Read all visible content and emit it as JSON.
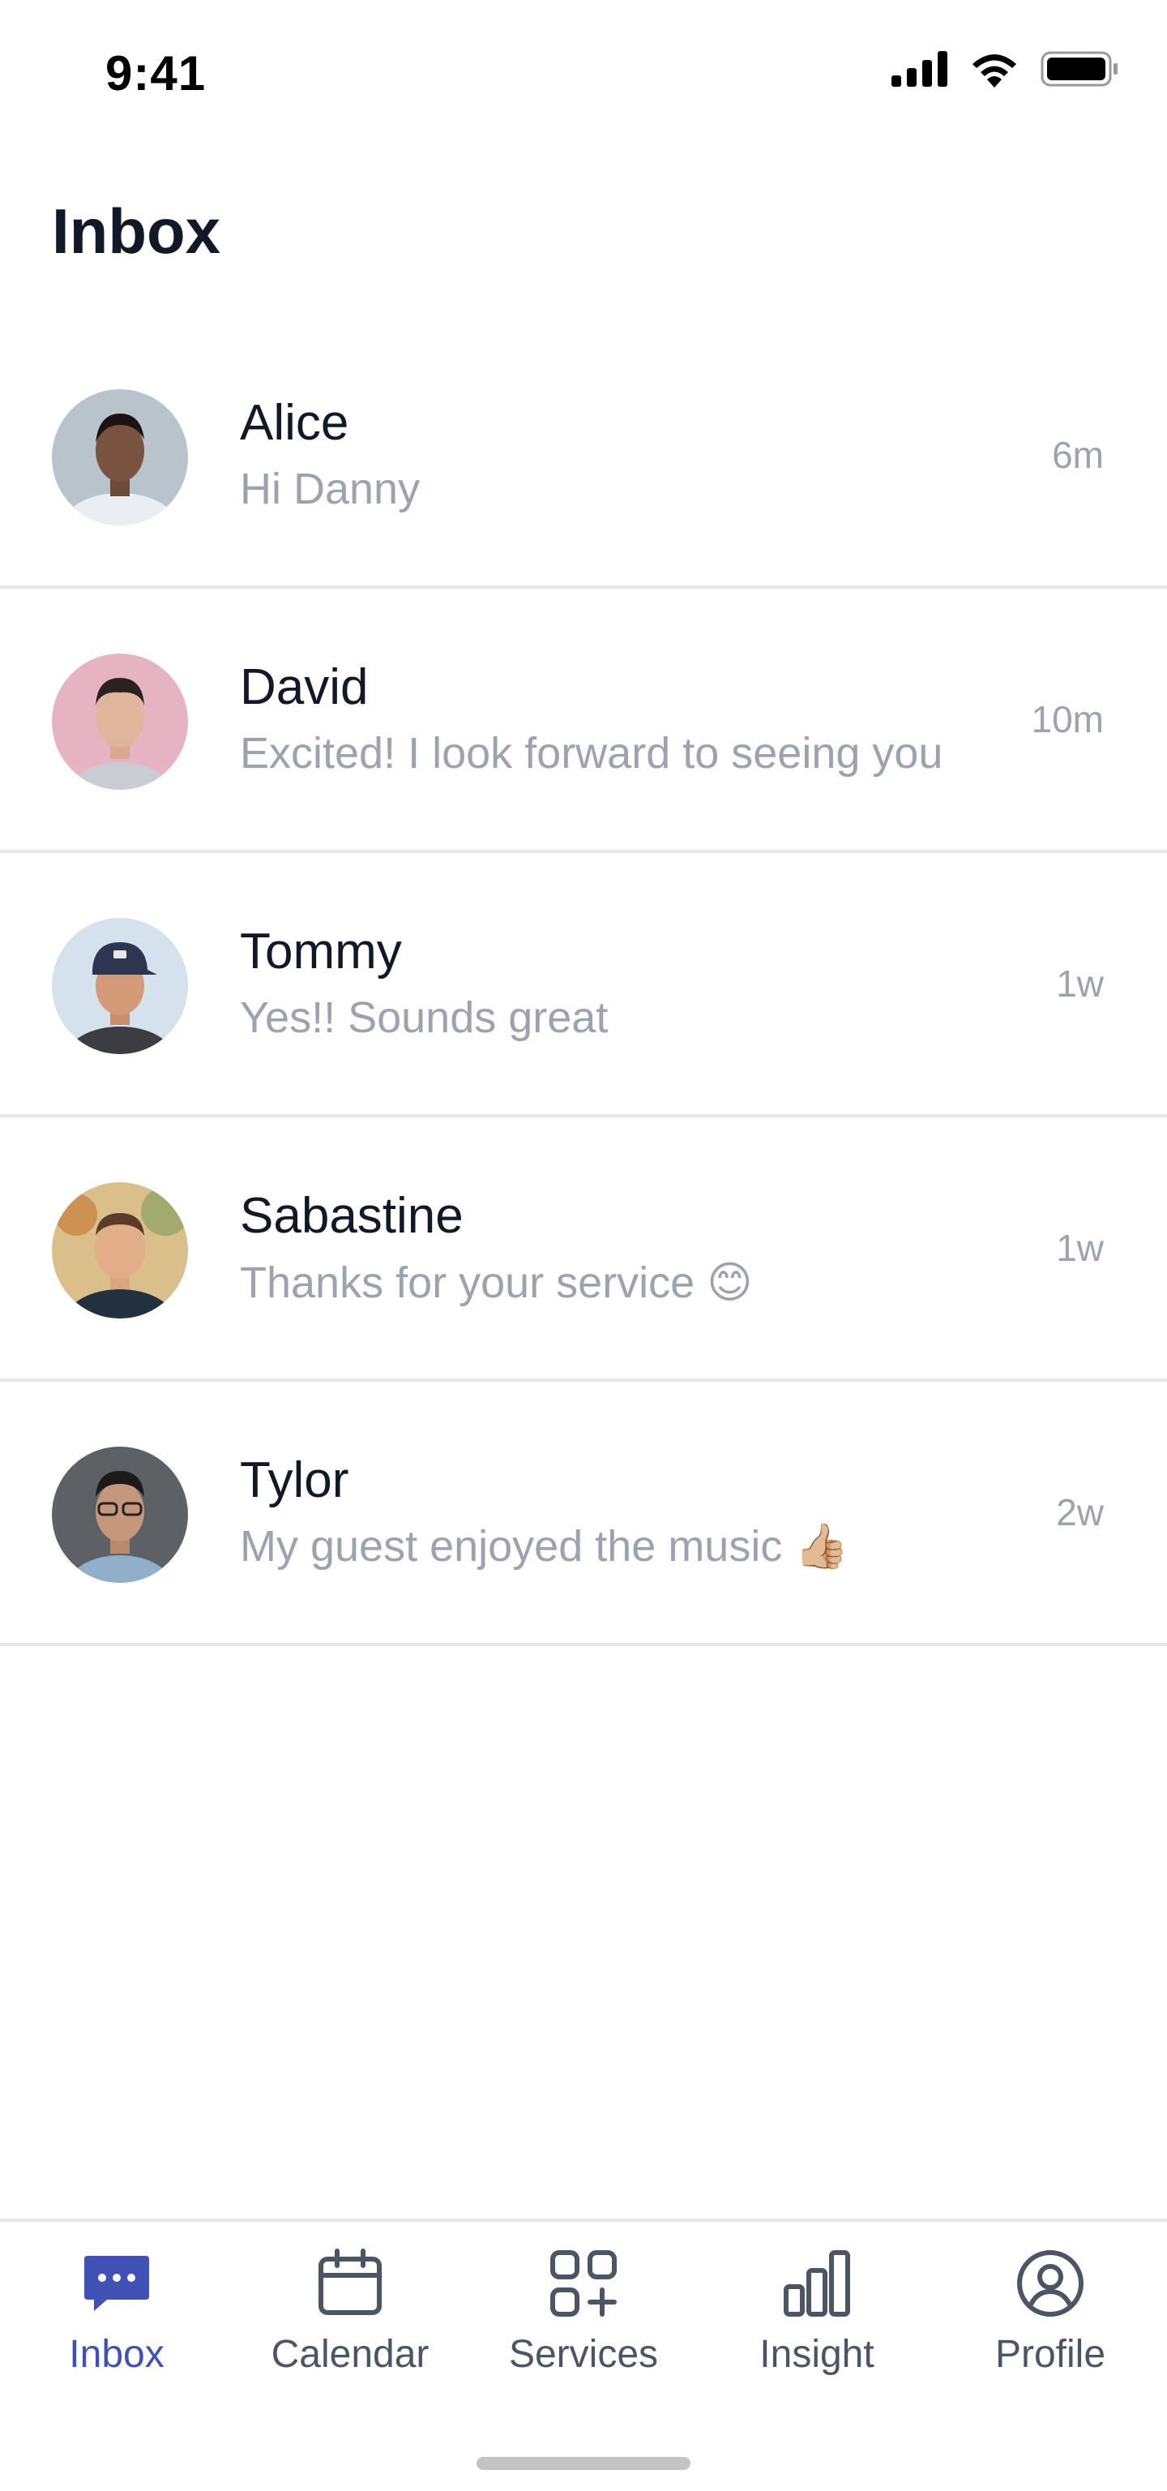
{
  "status_bar": {
    "time": "9:41",
    "icons": [
      "cellular-signal-icon",
      "wifi-icon",
      "battery-icon"
    ]
  },
  "header": {
    "title": "Inbox"
  },
  "conversations": [
    {
      "name": "Alice",
      "preview": "Hi Danny",
      "time": "6m",
      "avatar_icon": "avatar-alice"
    },
    {
      "name": "David",
      "preview": "Excited! I look forward to seeing you",
      "time": "10m",
      "avatar_icon": "avatar-david"
    },
    {
      "name": "Tommy",
      "preview": "Yes!! Sounds great",
      "time": "1w",
      "avatar_icon": "avatar-tommy"
    },
    {
      "name": "Sabastine",
      "preview": "Thanks for your service 😊",
      "time": "1w",
      "avatar_icon": "avatar-sabastine"
    },
    {
      "name": "Tylor",
      "preview": "My guest enjoyed the music 👍🏼",
      "time": "2w",
      "avatar_icon": "avatar-tylor"
    }
  ],
  "tab_bar": {
    "active": "Inbox",
    "tabs": [
      {
        "label": "Inbox",
        "icon": "chat-bubble-icon"
      },
      {
        "label": "Calendar",
        "icon": "calendar-icon"
      },
      {
        "label": "Services",
        "icon": "grid-plus-icon"
      },
      {
        "label": "Insight",
        "icon": "bar-chart-icon"
      },
      {
        "label": "Profile",
        "icon": "user-circle-icon"
      }
    ]
  },
  "colors": {
    "accent": "#3f51b5",
    "text_primary": "#111827",
    "text_secondary": "#9ca3af",
    "divider": "#e5e7eb",
    "tab_inactive": "#4b5563"
  }
}
